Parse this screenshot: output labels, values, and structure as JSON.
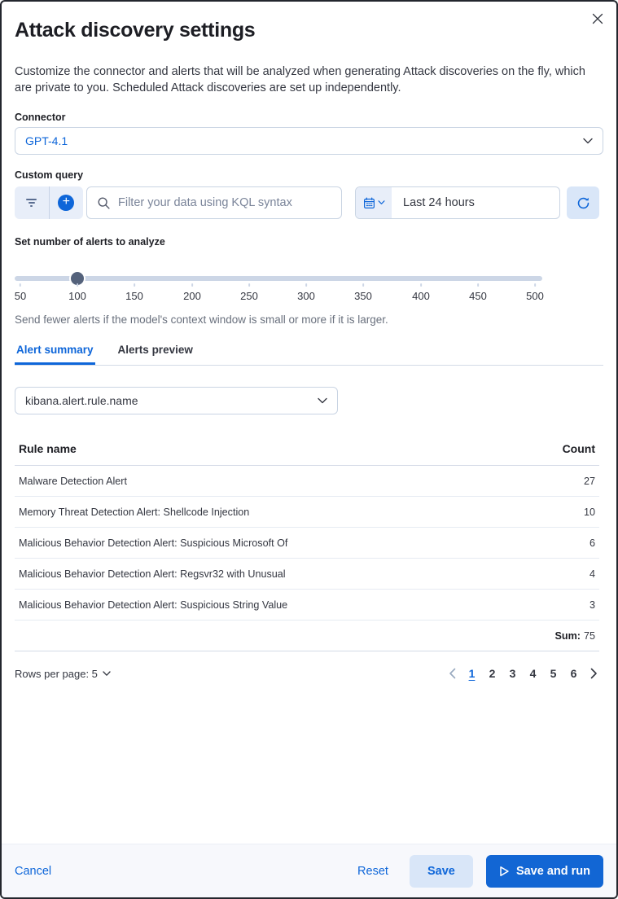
{
  "dialog": {
    "title": "Attack discovery settings",
    "description": "Customize the connector and alerts that will be analyzed when generating Attack discoveries on the fly, which are private to you. Scheduled Attack discoveries are set up independently."
  },
  "connector": {
    "label": "Connector",
    "selected": "GPT-4.1"
  },
  "custom_query": {
    "label": "Custom query",
    "search_placeholder": "Filter your data using KQL syntax",
    "time_range": "Last 24 hours"
  },
  "alerts_slider": {
    "label": "Set number of alerts to analyze",
    "value": 100,
    "min": 50,
    "max": 500,
    "ticks": [
      "50",
      "100",
      "150",
      "200",
      "250",
      "300",
      "350",
      "400",
      "450",
      "500"
    ],
    "help": "Send fewer alerts if the model's context window is small or more if it is larger."
  },
  "tabs": [
    {
      "label": "Alert summary",
      "active": true
    },
    {
      "label": "Alerts preview",
      "active": false
    }
  ],
  "field_selector": {
    "selected": "kibana.alert.rule.name"
  },
  "table": {
    "columns": [
      "Rule name",
      "Count"
    ],
    "rows": [
      {
        "name": "Malware Detection Alert",
        "count": "27"
      },
      {
        "name": "Memory Threat Detection Alert: Shellcode Injection",
        "count": "10"
      },
      {
        "name": "Malicious Behavior Detection Alert: Suspicious Microsoft Of",
        "count": "6"
      },
      {
        "name": "Malicious Behavior Detection Alert: Regsvr32 with Unusual",
        "count": "4"
      },
      {
        "name": "Malicious Behavior Detection Alert: Suspicious String Value",
        "count": "3"
      }
    ],
    "sum_label": "Sum:",
    "sum_value": "75"
  },
  "pagination": {
    "rows_per_page": "Rows per page: 5",
    "pages": [
      "1",
      "2",
      "3",
      "4",
      "5",
      "6"
    ],
    "active_page": "1"
  },
  "footer": {
    "cancel": "Cancel",
    "reset": "Reset",
    "save": "Save",
    "save_and_run": "Save and run"
  },
  "icons": {
    "close": "close-x",
    "filter": "filter-lines",
    "add_filter": "plus-in-circle",
    "search": "magnifier",
    "date": "calendar-with-chevron",
    "refresh": "circular-arrow",
    "select_chevron": "chevron-down",
    "prev": "chevron-left",
    "next": "chevron-right",
    "play": "play-triangle-outline"
  },
  "colors": {
    "accent": "#0e66d9",
    "primary_button_bg": "#1266d4",
    "secondary_button_bg": "#d9e6f8",
    "control_bg": "#e8eef9",
    "title_text": "#1d1e24",
    "body_text": "#343741",
    "muted_text": "#69707d",
    "input_border": "#c9d4e3",
    "divider": "#d3dae6",
    "row_border": "#e6ebf2",
    "footer_bg": "#f7f8fc",
    "slider_track": "#ccd6e6",
    "slider_thumb": "#54627b"
  }
}
